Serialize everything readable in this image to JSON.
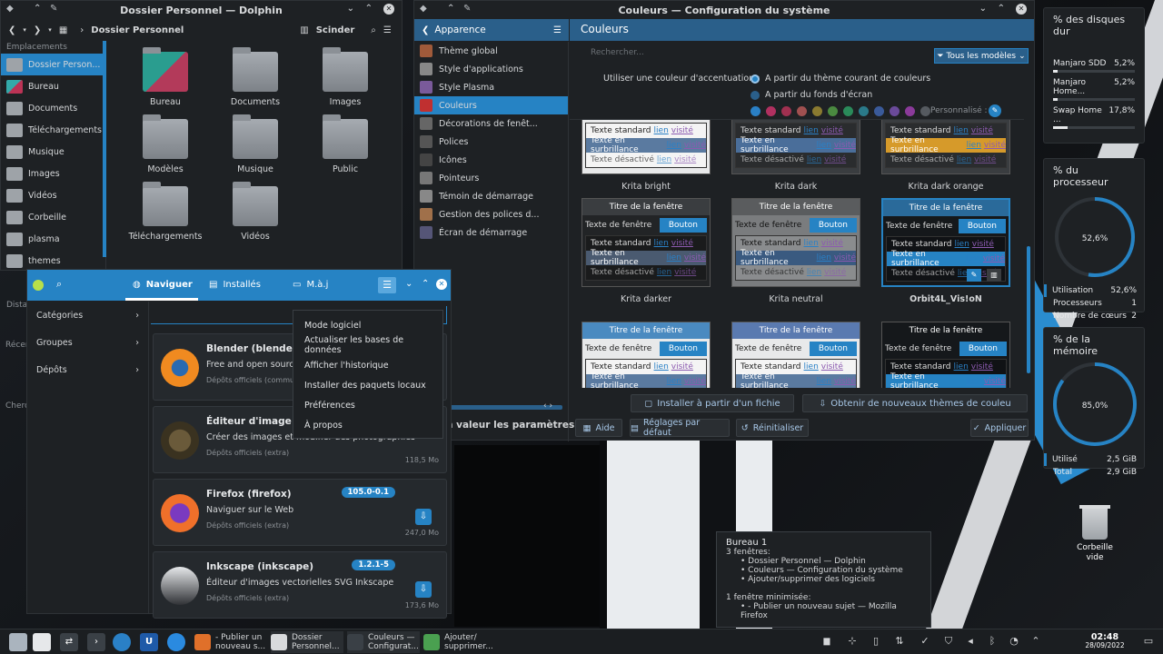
{
  "dolphin": {
    "title": "Dossier Personnel — Dolphin",
    "breadcrumb": "Dossier Personnel",
    "split": "Scinder",
    "places_header": "Emplacements",
    "places": [
      "Dossier Person...",
      "Bureau",
      "Documents",
      "Téléchargements",
      "Musique",
      "Images",
      "Vidéos",
      "Corbeille",
      "plasma",
      "themes"
    ],
    "other_headers": [
      "Dista",
      "Récen",
      "Cherc"
    ],
    "files": [
      {
        "name": "Bureau"
      },
      {
        "name": "Documents"
      },
      {
        "name": "Images"
      },
      {
        "name": "Modèles"
      },
      {
        "name": "Musique"
      },
      {
        "name": "Public"
      },
      {
        "name": "Téléchargements"
      },
      {
        "name": "Vidéos"
      }
    ]
  },
  "settings": {
    "title": "Couleurs — Configuration du système",
    "back": "Apparence",
    "page": "Couleurs",
    "search_placeholder": "Rechercher...",
    "all_schemes": "Tous les modèles",
    "sidebar": [
      "Thème global",
      "Style d'applications",
      "Style Plasma",
      "Couleurs",
      "Décorations de fenêt...",
      "Polices",
      "Icônes",
      "Pointeurs",
      "Témoin de démarrage",
      "Gestion des polices d...",
      "Écran de démarrage"
    ],
    "accent_label": "Utiliser une couleur d'accentuation :",
    "accent_opt1": "A partir du thème courant de couleurs",
    "accent_opt2": "A partir du fonds d'écran",
    "custom_label": "Personnalisé :",
    "swatches": [
      "#2a80c6",
      "#b03060",
      "#a03050",
      "#a05050",
      "#8a7a30",
      "#4a8a40",
      "#2a8a5a",
      "#2a7a8a",
      "#3a5a9a",
      "#6a4a9a",
      "#8a3a9a",
      "#555a60"
    ],
    "scheme_labels": {
      "window_title": "Titre de la fenêtre",
      "window_text": "Texte de fenêtre",
      "button": "Bouton",
      "standard": "Texte standard",
      "link": "lien",
      "visited": "visité",
      "hover": "Texte en surbrillance",
      "disabled": "Texte désactivé"
    },
    "schemes": [
      "Krita bright",
      "Krita dark",
      "Krita dark orange",
      "Krita darker",
      "Krita neutral",
      "Orbit4L_Vis!oN"
    ],
    "install_file": "Installer à partir d'un fichie",
    "get_new": "Obtenir de nouveaux thèmes de couleu",
    "help": "Aide",
    "defaults": "Réglages par défaut",
    "reset": "Réinitialiser",
    "apply": "Appliquer",
    "partial_text": "n valeur les paramètres"
  },
  "discover": {
    "tab_browse": "Naviguer",
    "tab_installed": "Installés",
    "tab_updates": "M.à.j",
    "nav": [
      "Catégories",
      "Groupes",
      "Dépôts"
    ],
    "menu": [
      "Mode logiciel",
      "Actualiser les bases de données",
      "Afficher l'historique",
      "Installer des paquets locaux",
      "Préférences",
      "À propos"
    ],
    "apps": [
      {
        "name": "Blender (blender)",
        "desc": "Free and open source ",
        "src": "Dépôts officiels (commun",
        "version": "",
        "size": ""
      },
      {
        "name": "Éditeur d'image GI",
        "desc": "Créer des images et modifier des photographies",
        "src": "Dépôts officiels (extra)",
        "version": "",
        "size": "118,5 Mo"
      },
      {
        "name": "Firefox (firefox)",
        "desc": "Naviguer sur le Web",
        "src": "Dépôts officiels (extra)",
        "version": "105.0-0.1",
        "size": "247,0 Mo"
      },
      {
        "name": "Inkscape (inkscape)",
        "desc": "Éditeur d'images vectorielles SVG Inkscape",
        "src": "Dépôts officiels (extra)",
        "version": "1.2.1-5",
        "size": "173,6 Mo"
      }
    ]
  },
  "widgets": {
    "disks_title": "% des disques dur",
    "disks": [
      {
        "name": "Manjaro SDD",
        "value": "5,2%",
        "fraction": 0.052
      },
      {
        "name": "Manjaro Home...",
        "value": "5,2%",
        "fraction": 0.052
      },
      {
        "name": "Swap Home ...",
        "value": "17,8%",
        "fraction": 0.178
      }
    ],
    "cpu_title": "% du processeur",
    "cpu_value": "52,6%",
    "cpu_fraction": 0.526,
    "cpu_stats": [
      {
        "label": "Utilisation",
        "value": "52,6%"
      },
      {
        "label": "Processeurs",
        "value": "1"
      },
      {
        "label": "Nombre de cœurs",
        "value": "2"
      }
    ],
    "mem_title": "% de la mémoire",
    "mem_value": "85,0%",
    "mem_fraction": 0.85,
    "mem_stats": [
      {
        "label": "Utilisé",
        "value": "2,5 GiB"
      },
      {
        "label": "Total",
        "value": "2,9 GiB"
      }
    ]
  },
  "desktop": {
    "trash": "Corbeille vide"
  },
  "tooltip": {
    "title": "Bureau 1",
    "count": "3 fenêtres:",
    "windows": [
      "Dossier Personnel — Dolphin",
      "Couleurs — Configuration du système",
      "Ajouter/supprimer des logiciels"
    ],
    "minimized": "1 fenêtre minimisée:",
    "min_windows": [
      "- Publier un nouveau sujet — Mozilla Firefox"
    ]
  },
  "taskbar": {
    "tasks": [
      {
        "label1": "- Publier un",
        "label2": "nouveau s..."
      },
      {
        "label1": "Dossier",
        "label2": "Personnel..."
      },
      {
        "label1": "Couleurs —",
        "label2": "Configurat..."
      },
      {
        "label1": "Ajouter/",
        "label2": "supprimer..."
      }
    ],
    "time": "02:48",
    "date": "28/09/2022"
  }
}
